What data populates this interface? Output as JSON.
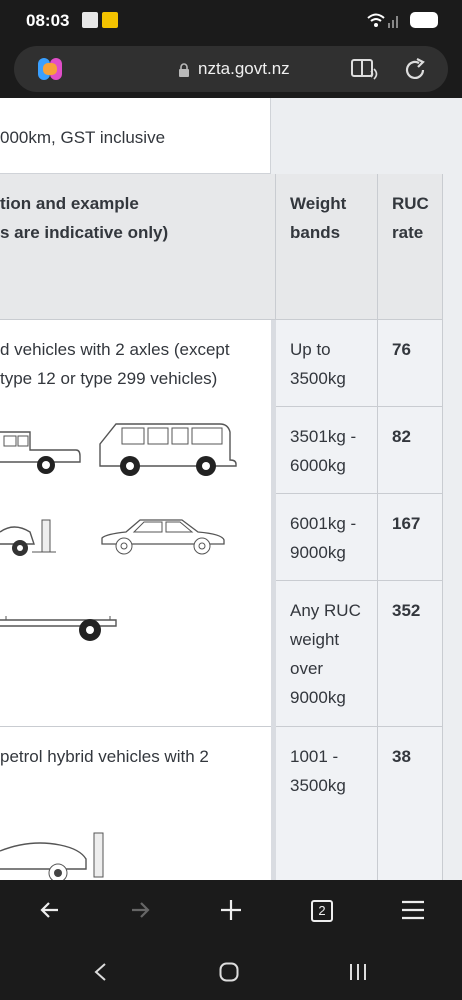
{
  "status": {
    "time": "08:03"
  },
  "browser": {
    "url": "nzta.govt.nz",
    "tab_count": "2"
  },
  "page": {
    "caption": "000km, GST inclusive",
    "table": {
      "headers": {
        "description_line1": "tion and example",
        "description_line2": "s are indicative only)",
        "weight_line1": "Weight",
        "weight_line2": "bands",
        "rate_line1": "RUC",
        "rate_line2": "rate"
      },
      "groups": [
        {
          "desc_line1": "d vehicles with 2 axles (except",
          "desc_line2": "type 12 or type 299 vehicles)",
          "rows": [
            {
              "weight_line1": "Up to",
              "weight_line2": "3500kg",
              "rate": "76"
            },
            {
              "weight_line1": "3501kg -",
              "weight_line2": "6000kg",
              "rate": "82"
            },
            {
              "weight_line1": "6001kg -",
              "weight_line2": "9000kg",
              "rate": "167"
            },
            {
              "weight_line1": "Any RUC",
              "weight_line2": "weight",
              "weight_line3": "over",
              "weight_line4": "9000kg",
              "rate": "352"
            }
          ]
        },
        {
          "desc_line1": "petrol hybrid vehicles with 2",
          "rows": [
            {
              "weight_line1": "1001 -",
              "weight_line2": "3500kg",
              "rate": "38"
            }
          ]
        }
      ]
    }
  },
  "icons": {
    "statusbar": [
      "notification-icon",
      "app-icon",
      "wifi-icon",
      "signal-icon",
      "battery-icon"
    ],
    "browser": [
      "copilot-icon",
      "lock-icon",
      "reader-mode-icon",
      "reload-icon"
    ],
    "bottom_nav": [
      "back-arrow-icon",
      "forward-arrow-icon",
      "new-tab-icon",
      "tabs-icon",
      "menu-icon"
    ],
    "system_nav": [
      "system-back-icon",
      "home-icon",
      "recents-icon"
    ]
  },
  "colors": {
    "header_bg": "#e7e8ea",
    "border": "#c9ccd1",
    "text": "#33373d",
    "chrome": "#1b1b1b"
  }
}
